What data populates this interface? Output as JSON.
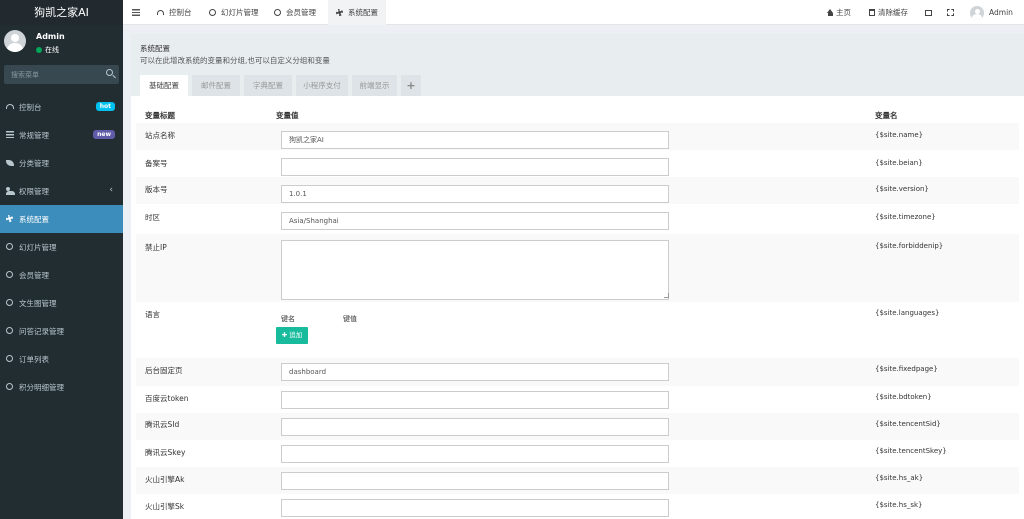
{
  "app": {
    "logo": "狗凯之家AI"
  },
  "user": {
    "name": "Admin",
    "status": "在线"
  },
  "search": {
    "placeholder": "搜索菜单"
  },
  "sidebar": {
    "items": [
      {
        "label": "控制台",
        "icon": "dashboard-icon",
        "badge": "hot",
        "badge_color": "#00c0ef"
      },
      {
        "label": "常规管理",
        "icon": "list-icon",
        "badge": "new",
        "badge_color": "#605ca8"
      },
      {
        "label": "分类管理",
        "icon": "leaf-icon"
      },
      {
        "label": "权限管理",
        "icon": "users-icon",
        "expand": "‹"
      },
      {
        "label": "系统配置",
        "icon": "gear-icon",
        "active": true
      },
      {
        "label": "幻灯片管理",
        "icon": "circle-icon"
      },
      {
        "label": "会员管理",
        "icon": "circle-icon"
      },
      {
        "label": "文生图管理",
        "icon": "circle-icon"
      },
      {
        "label": "问答记录管理",
        "icon": "circle-icon"
      },
      {
        "label": "订单列表",
        "icon": "circle-icon"
      },
      {
        "label": "积分明细管理",
        "icon": "circle-icon"
      }
    ]
  },
  "header": {
    "tabs": [
      {
        "label": "控制台",
        "icon": "dashboard-icon"
      },
      {
        "label": "幻灯片管理",
        "icon": "circle-icon"
      },
      {
        "label": "会员管理",
        "icon": "circle-icon"
      },
      {
        "label": "系统配置",
        "icon": "gear-icon",
        "active": true
      }
    ],
    "right": {
      "home": "主页",
      "clear_cache": "清除缓存",
      "user": "Admin"
    }
  },
  "panel": {
    "title": "系统配置",
    "description": "可以在此增改系统的变量和分组,也可以自定义分组和变量",
    "tabs": [
      "基础配置",
      "邮件配置",
      "字典配置",
      "小程序支付",
      "前端显示",
      "+"
    ]
  },
  "table": {
    "headers": {
      "title": "变量标题",
      "value": "变量值",
      "name": "变量名"
    },
    "rows": [
      {
        "title": "站点名称",
        "value": "狗凯之家AI",
        "var": "{$site.name}"
      },
      {
        "title": "备案号",
        "value": "",
        "var": "{$site.beian}"
      },
      {
        "title": "版本号",
        "value": "1.0.1",
        "var": "{$site.version}"
      },
      {
        "title": "时区",
        "value": "Asia/Shanghai",
        "var": "{$site.timezone}"
      },
      {
        "title": "禁止IP",
        "value": "",
        "var": "{$site.forbiddenip}"
      },
      {
        "title": "语言",
        "key_label": "键名",
        "val_label": "键值",
        "add_label": "追加",
        "var": "{$site.languages}"
      },
      {
        "title": "后台固定页",
        "value": "dashboard",
        "var": "{$site.fixedpage}"
      },
      {
        "title": "百度云token",
        "value": "",
        "var": "{$site.bdtoken}"
      },
      {
        "title": "腾讯云SId",
        "value": "",
        "var": "{$site.tencentSid}"
      },
      {
        "title": "腾讯云Skey",
        "value": "",
        "var": "{$site.tencentSkey}"
      },
      {
        "title": "火山引擎Ak",
        "value": "",
        "var": "{$site.hs_ak}"
      },
      {
        "title": "火山引擎Sk",
        "value": "",
        "var": "{$site.hs_sk}"
      }
    ]
  },
  "colors": {
    "sidebar_bg": "#222d32",
    "accent": "#3c8dbc",
    "success": "#18bc9c"
  }
}
